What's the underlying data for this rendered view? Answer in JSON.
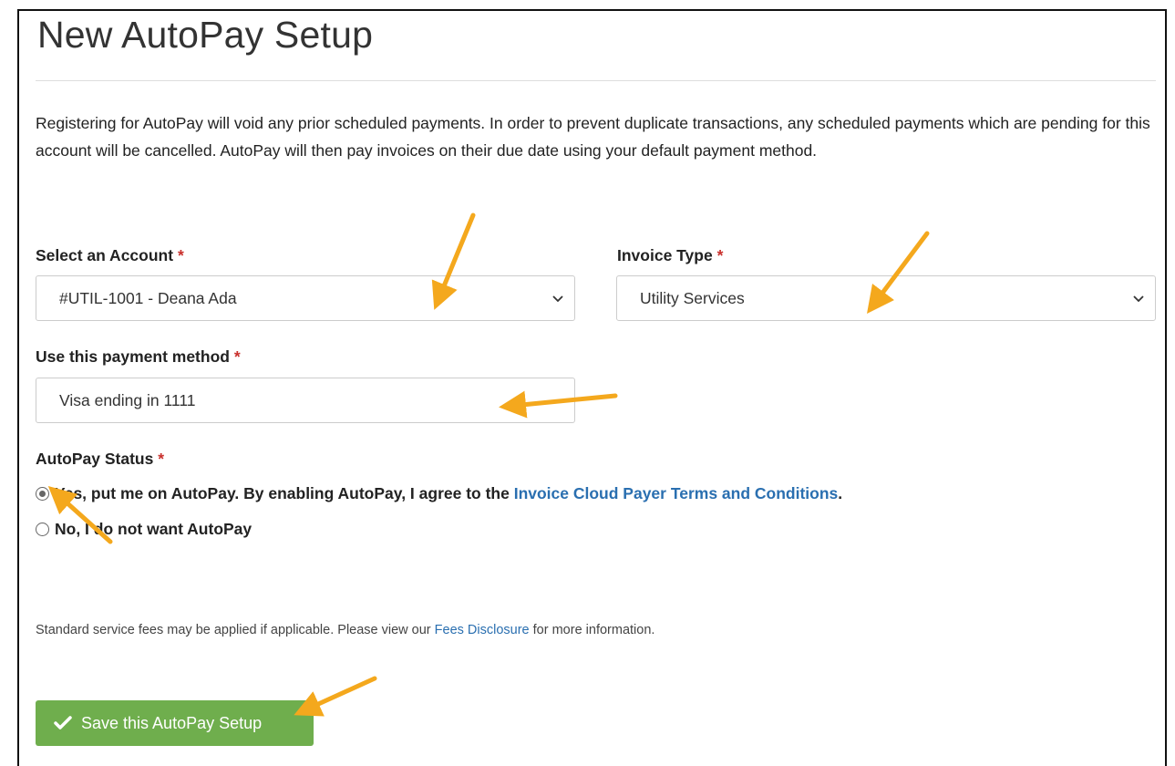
{
  "page": {
    "title": "New AutoPay Setup",
    "intro": "Registering for AutoPay will void any prior scheduled payments. In order to prevent duplicate transactions, any scheduled payments which are pending for this account will be cancelled. AutoPay will then pay invoices on their due date using your default payment method."
  },
  "form": {
    "account": {
      "label": "Select an Account",
      "required_mark": "*",
      "value": "#UTIL-1001 - Deana Ada"
    },
    "invoice_type": {
      "label": "Invoice Type",
      "required_mark": "*",
      "value": "Utility Services"
    },
    "payment_method": {
      "label": "Use this payment method",
      "required_mark": "*",
      "value": "Visa ending in 1111"
    },
    "autopay_status": {
      "label": "AutoPay Status",
      "required_mark": "*",
      "yes_text": "Yes, put me on AutoPay. By enabling AutoPay, I agree to the ",
      "yes_link": "Invoice Cloud Payer Terms and Conditions",
      "yes_suffix": ".",
      "no_text": "No, I do not want AutoPay",
      "selected": "yes"
    }
  },
  "fees": {
    "prefix": "Standard service fees may be applied if applicable. Please view our ",
    "link": "Fees Disclosure",
    "suffix": " for more information."
  },
  "actions": {
    "save_label": "Save this AutoPay Setup"
  },
  "icons": {
    "dropdown": "chevron-down-icon",
    "save": "checkmark-icon",
    "annotation": "arrow-icon"
  },
  "colors": {
    "save_button": "#6fae4d",
    "link": "#2a6fb0",
    "required": "#c9302c",
    "annotation_arrow": "#f4a81d"
  }
}
